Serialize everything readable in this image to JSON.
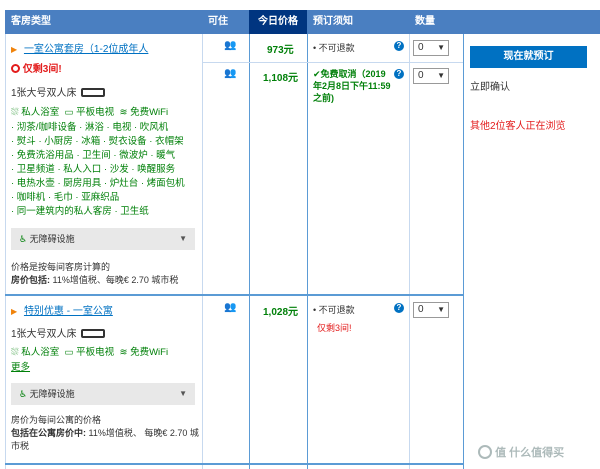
{
  "header": {
    "room_type": "客房类型",
    "occupancy": "可住",
    "today_price": "今日价格",
    "booking_notes": "预订须知",
    "quantity": "数量"
  },
  "room1": {
    "title": "一室公寓套房（1-2位成年人",
    "scarcity": "仅剩3间!",
    "bed": "1张大号双人床",
    "facilities_main": [
      "私人浴室",
      "平板电视",
      "免费WiFi"
    ],
    "facilities_list": [
      "· 沏茶/咖啡设备 · 淋浴 · 电视 · 吹风机",
      "· 熨斗 · 小厨房 · 冰箱 · 熨衣设备 · 衣帽架",
      "· 免费洗浴用品 · 卫生间 · 微波炉 · 暖气",
      "· 卫星频道 · 私人入口 · 沙发 · 唤醒服务",
      "· 电热水壶 · 厨房用具 · 炉灶台 · 烤面包机",
      "· 咖啡机 · 毛巾 · 亚麻织品",
      "· 同一建筑内的私人客房 · 卫生纸"
    ],
    "accessibility": "无障碍设施",
    "price_note": "价格是按每间客房计算的",
    "price_includes_label": "房价包括:",
    "price_includes": " 11%增值税、每晚€ 2.70 城市税",
    "options": [
      {
        "price": "973元",
        "policy": "不可退款",
        "qty": "0"
      },
      {
        "price": "1,108元",
        "policy": "免费取消（2019年2月8日下午11:59之前)",
        "qty": "0"
      }
    ]
  },
  "room2": {
    "title": "特别优惠 - 一室公寓",
    "bed": "1张大号双人床",
    "facilities_main": [
      "私人浴室",
      "平板电视",
      "免费WiFi"
    ],
    "more": "更多",
    "accessibility": "无障碍设施",
    "price_note": "房价为每间公寓的价格",
    "price_includes_label": "包括在公寓房价中:",
    "price_includes": " 11%增值税、 每晚€ 2.70 城市税",
    "options": [
      {
        "price": "1,028元",
        "policy": "不可退款",
        "scarcity": "仅剩3间!",
        "qty": "0"
      }
    ]
  },
  "sidebar": {
    "book_button": "现在就预订",
    "instant_confirm": "立即确认",
    "viewing_notice": "其他2位客人正在浏览"
  },
  "watermark": "值 什么值得买"
}
